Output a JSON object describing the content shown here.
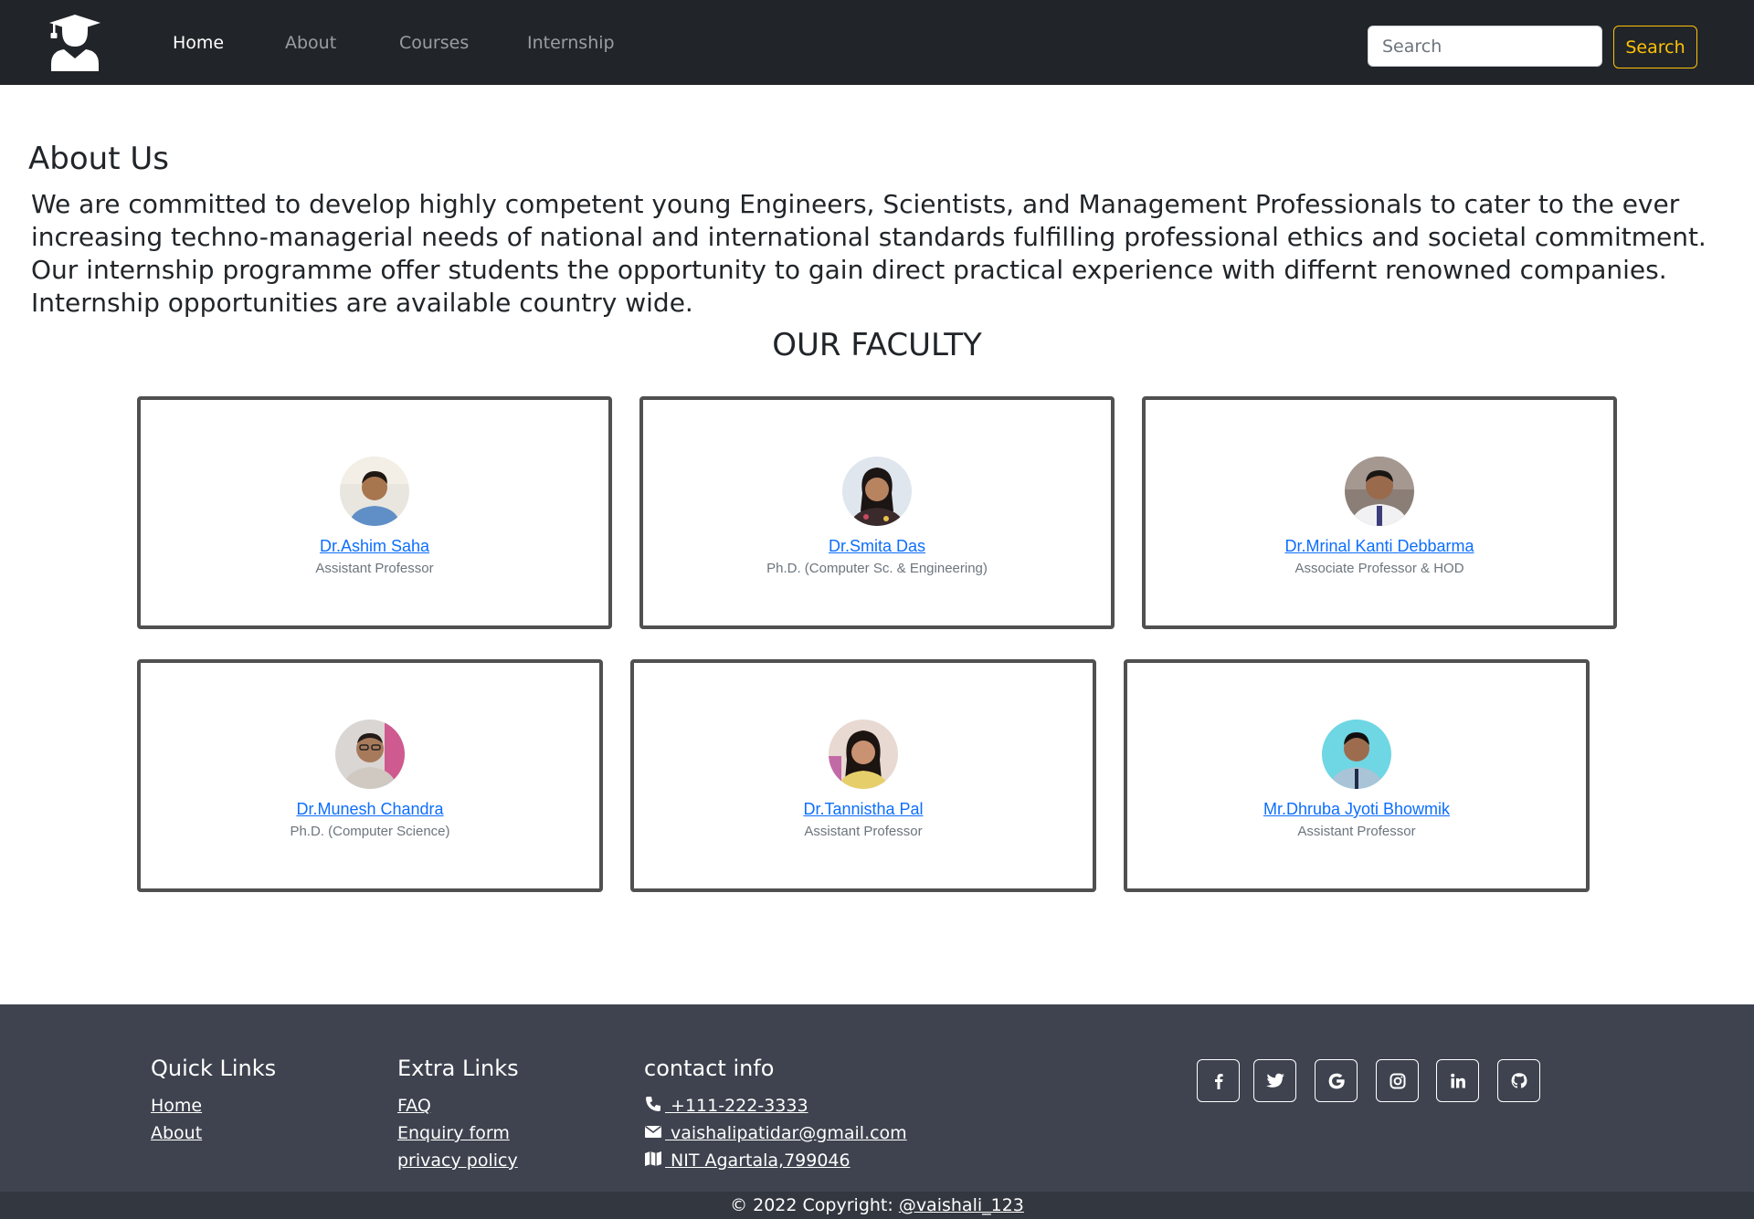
{
  "navbar": {
    "logo_icon": "graduate-icon",
    "links": [
      {
        "label": "Home",
        "active": true
      },
      {
        "label": "About",
        "active": false
      },
      {
        "label": "Courses",
        "active": false
      },
      {
        "label": "Internship",
        "active": false
      }
    ],
    "search_placeholder": "Search",
    "search_button": "Search"
  },
  "about": {
    "title": "About Us",
    "text": "We are committed to develop highly competent young Engineers, Scientists, and Management Professionals to cater to the ever increasing techno-managerial needs of national and international standards fulfilling professional ethics and societal commitment. Our internship programme offer students the opportunity to gain direct practical experience with differnt renowned companies. Internship opportunities are available country wide."
  },
  "faculty": {
    "title": "OUR FACULTY",
    "members": [
      {
        "name": "Dr.Ashim Saha",
        "role": "Assistant Professor"
      },
      {
        "name": "Dr.Smita Das",
        "role": "Ph.D. (Computer Sc. & Engineering)"
      },
      {
        "name": "Dr.Mrinal Kanti Debbarma",
        "role": "Associate Professor & HOD"
      },
      {
        "name": "Dr.Munesh Chandra",
        "role": "Ph.D. (Computer Science)"
      },
      {
        "name": "Dr.Tannistha Pal",
        "role": "Assistant Professor"
      },
      {
        "name": "Mr.Dhruba Jyoti Bhowmik",
        "role": "Assistant Professor"
      }
    ]
  },
  "footer": {
    "quick_links": {
      "title": "Quick Links",
      "items": [
        "Home",
        "About"
      ]
    },
    "extra_links": {
      "title": "Extra Links",
      "items": [
        "FAQ",
        "Enquiry form",
        "privacy policy"
      ]
    },
    "contact": {
      "title": "contact info",
      "phone": " +111-222-3333",
      "email": " vaishalipatidar@gmail.com",
      "address": " NIT Agartala,799046"
    },
    "social_icons": [
      "facebook-icon",
      "twitter-icon",
      "google-icon",
      "instagram-icon",
      "linkedin-icon",
      "github-icon"
    ],
    "copyright_prefix": "© 2022 Copyright: ",
    "copyright_handle": "@vaishali_123"
  },
  "colors": {
    "navbar_bg": "#212529",
    "search_accent": "#ffc107",
    "footer_bg": "#3e434f",
    "link_blue": "#0d6efd"
  }
}
